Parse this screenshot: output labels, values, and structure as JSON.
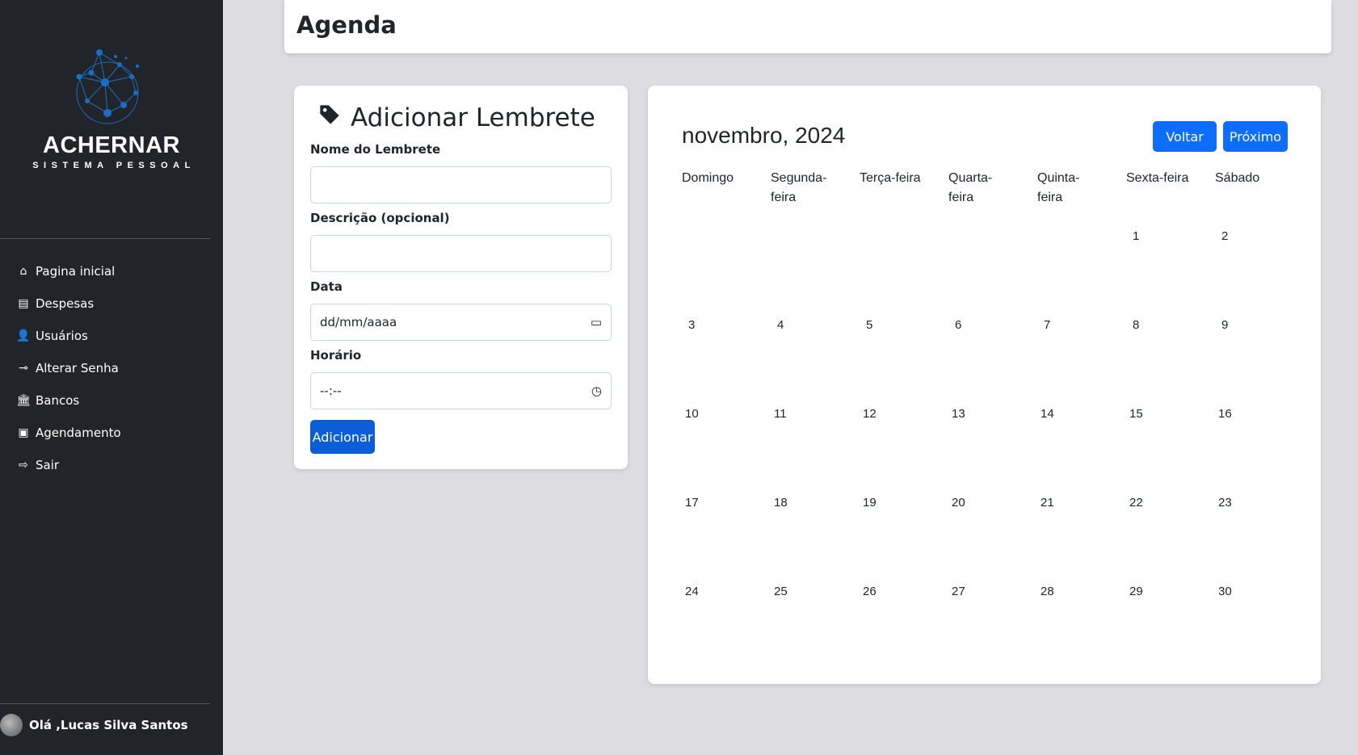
{
  "sidebar": {
    "brand": "ACHERNAR",
    "brand_sub": "SISTEMA PESSOAL",
    "items": [
      {
        "label": "Pagina inicial",
        "icon": "house-icon"
      },
      {
        "label": "Despesas",
        "icon": "id-card-icon"
      },
      {
        "label": "Usuários",
        "icon": "user-gear-icon"
      },
      {
        "label": "Alterar Senha",
        "icon": "key-icon"
      },
      {
        "label": "Bancos",
        "icon": "bank-icon"
      },
      {
        "label": "Agendamento",
        "icon": "calendar-check-icon"
      },
      {
        "label": "Sair",
        "icon": "logout-icon"
      }
    ],
    "user_greeting": "Olá ,Lucas Silva Santos"
  },
  "header": {
    "title": "Agenda"
  },
  "form": {
    "title": "Adicionar Lembrete",
    "name_label": "Nome do Lembrete",
    "name_value": "",
    "desc_label": "Descrição (opcional)",
    "desc_value": "",
    "date_label": "Data",
    "date_placeholder": "dd/mm/aaaa",
    "time_label": "Horário",
    "time_placeholder": "--:--",
    "submit_label": "Adicionar"
  },
  "calendar": {
    "title": "novembro, 2024",
    "prev_label": "Voltar",
    "next_label": "Próximo",
    "weekdays": [
      "Domingo",
      "Segunda-\nfeira",
      "Terça-feira",
      "Quarta-\nfeira",
      "Quinta-\nfeira",
      "Sexta-feira",
      "Sábado"
    ],
    "first_weekday": 5,
    "days_in_month": 30
  },
  "colors": {
    "primary": "#0d6efd",
    "sidebar": "#212529",
    "logo": "#1a6fc2"
  }
}
